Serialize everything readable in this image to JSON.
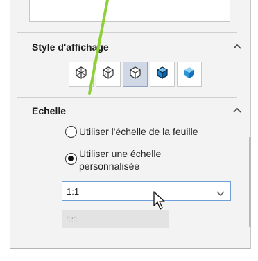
{
  "display_style": {
    "title": "Style d'affichage",
    "buttons": [
      {
        "icon": "wireframe-icon"
      },
      {
        "icon": "hidden-lines-visible-icon"
      },
      {
        "icon": "hidden-lines-removed-icon",
        "selected": true
      },
      {
        "icon": "shaded-with-edges-icon"
      },
      {
        "icon": "shaded-icon"
      }
    ]
  },
  "scale": {
    "title": "Echelle",
    "options": [
      {
        "label": "Utiliser l'échelle de la feuille",
        "checked": false
      },
      {
        "label_line1": "Utiliser une échelle",
        "label_line2": "personnalisée",
        "checked": true
      }
    ],
    "combo_value": "1:1",
    "custom_value": "1:1"
  },
  "colors": {
    "accent_line": "#8fcf3a",
    "selected_button": "#cfd8e4",
    "combo_border": "#6f9ed8"
  }
}
